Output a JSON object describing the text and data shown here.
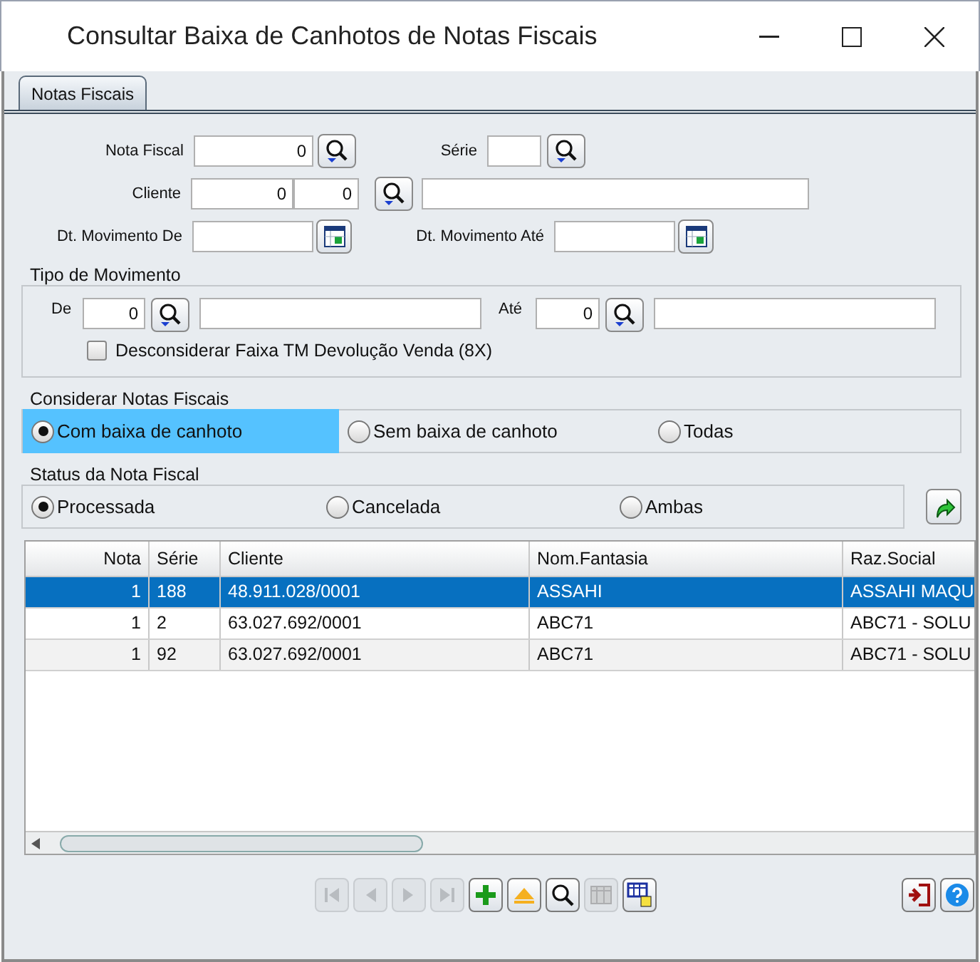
{
  "window": {
    "title": "Consultar Baixa de Canhotos de Notas Fiscais"
  },
  "tabs": [
    {
      "label": "Notas Fiscais",
      "selected": true
    }
  ],
  "form": {
    "nota_fiscal": {
      "label": "Nota Fiscal",
      "value": "0"
    },
    "serie": {
      "label": "Série"
    },
    "cliente": {
      "label": "Cliente",
      "code": "0",
      "branch": "0"
    },
    "dt_de": {
      "label": "Dt. Movimento De"
    },
    "dt_ate": {
      "label": "Dt. Movimento Até"
    }
  },
  "tipo_movimento": {
    "title": "Tipo de Movimento",
    "de": {
      "label": "De",
      "value": "0"
    },
    "ate": {
      "label": "Até",
      "value": "0"
    },
    "checkbox": {
      "label": "Desconsiderar Faixa TM Devolução Venda (8X)",
      "checked": false
    }
  },
  "considerar": {
    "title": "Considerar Notas Fiscais",
    "options": [
      {
        "label": "Com baixa de canhoto",
        "selected": true,
        "focused": true
      },
      {
        "label": "Sem baixa de canhoto",
        "selected": false,
        "focused": false
      },
      {
        "label": "Todas",
        "selected": false,
        "focused": false
      }
    ]
  },
  "status": {
    "title": "Status da Nota Fiscal",
    "options": [
      {
        "label": "Processada",
        "selected": true
      },
      {
        "label": "Cancelada",
        "selected": false
      },
      {
        "label": "Ambas",
        "selected": false
      }
    ]
  },
  "table": {
    "columns": [
      "Nota",
      "Série",
      "Cliente",
      "Nom.Fantasia",
      "Raz.Social"
    ],
    "rows": [
      {
        "cells": [
          "1",
          "188",
          "48.911.028/0001",
          "ASSAHI",
          "ASSAHI MAQU"
        ],
        "selected": true
      },
      {
        "cells": [
          "1",
          "2",
          "63.027.692/0001",
          "ABC71",
          "ABC71 - SOLU"
        ],
        "selected": false
      },
      {
        "cells": [
          "1",
          "92",
          "63.027.692/0001",
          "ABC71",
          "ABC71 - SOLU"
        ],
        "selected": false
      }
    ]
  },
  "toolbar": [
    {
      "kind": "first",
      "disabled": true
    },
    {
      "kind": "prev",
      "disabled": true
    },
    {
      "kind": "next",
      "disabled": true
    },
    {
      "kind": "last",
      "disabled": true
    },
    {
      "kind": "add",
      "disabled": false
    },
    {
      "kind": "eject",
      "disabled": false
    },
    {
      "kind": "search",
      "disabled": false
    },
    {
      "kind": "grid",
      "disabled": true
    },
    {
      "kind": "export",
      "disabled": false
    }
  ],
  "actions": [
    {
      "kind": "exit"
    },
    {
      "kind": "help"
    }
  ]
}
